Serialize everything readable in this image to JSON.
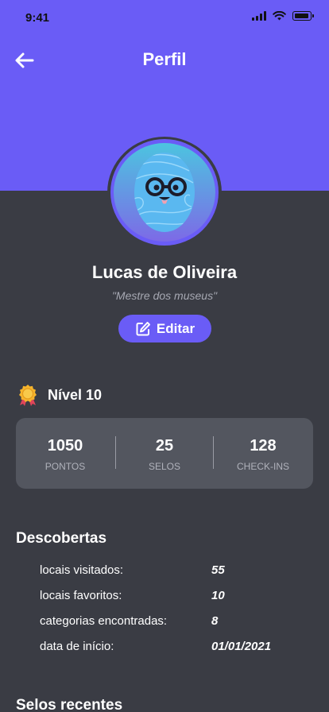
{
  "status_bar": {
    "time": "9:41"
  },
  "header": {
    "title": "Perfil",
    "back_icon": "arrow-left-icon"
  },
  "profile": {
    "name": "Lucas de Oliveira",
    "subtitle": "\"Mestre dos museus\"",
    "edit_label": "Editar"
  },
  "level": {
    "label": "Nível 10",
    "icon": "medal-icon"
  },
  "stats": [
    {
      "value": "1050",
      "label": "PONTOS"
    },
    {
      "value": "25",
      "label": "SELOS"
    },
    {
      "value": "128",
      "label": "CHECK-INS"
    }
  ],
  "discoveries": {
    "title": "Descobertas",
    "rows": [
      {
        "key": "locais visitados:",
        "value": "55"
      },
      {
        "key": "locais favoritos:",
        "value": "10"
      },
      {
        "key": "categorias encontradas:",
        "value": "8"
      },
      {
        "key": "data de início:",
        "value": "01/01/2021"
      }
    ]
  },
  "recent_badges": {
    "title": "Selos recentes"
  },
  "colors": {
    "accent": "#6a5cf6",
    "background": "#3a3c44",
    "card": "#53565f"
  }
}
